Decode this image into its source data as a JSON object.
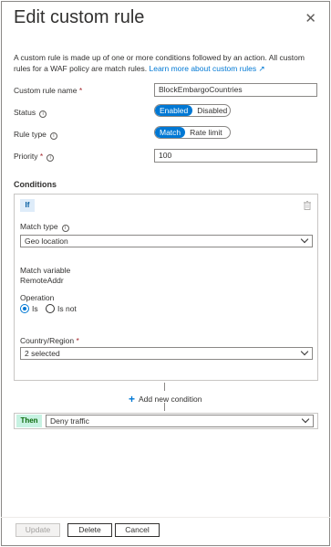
{
  "panel": {
    "title": "Edit custom rule",
    "description": "A custom rule is made up of one or more conditions followed by an action. All custom rules for a WAF policy are match rules.",
    "learn_more": "Learn more about custom rules",
    "link_icon": "external-link-icon"
  },
  "form": {
    "name_label": "Custom rule name",
    "name_value": "BlockEmbargoCountries",
    "status_label": "Status",
    "status_options": [
      "Enabled",
      "Disabled"
    ],
    "status_selected": "Enabled",
    "ruletype_label": "Rule type",
    "ruletype_options": [
      "Match",
      "Rate limit"
    ],
    "ruletype_selected": "Match",
    "priority_label": "Priority",
    "priority_value": "100",
    "required_marker": "*"
  },
  "conditions": {
    "heading": "Conditions",
    "if_label": "If",
    "match_type_label": "Match type",
    "match_type_value": "Geo location",
    "match_variable_label": "Match variable",
    "match_variable_value": "RemoteAddr",
    "operation_label": "Operation",
    "operation_options": [
      "Is",
      "Is not"
    ],
    "operation_selected": "Is",
    "country_label": "Country/Region",
    "country_value": "2 selected",
    "add_condition": "Add new condition"
  },
  "then": {
    "label": "Then",
    "action_value": "Deny traffic"
  },
  "footer": {
    "update": "Update",
    "delete": "Delete",
    "cancel": "Cancel"
  },
  "colors": {
    "accent": "#0078d4",
    "required": "#a4262c",
    "then_badge": "#c7f2e2",
    "if_badge": "#deecf9"
  }
}
